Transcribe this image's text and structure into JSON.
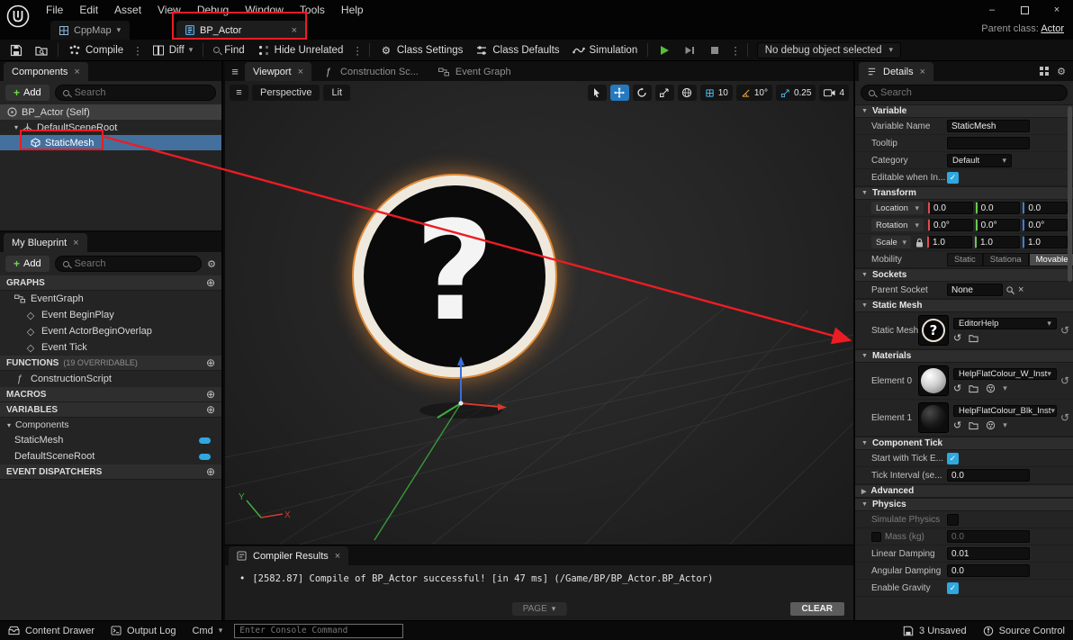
{
  "window": {
    "menus": [
      "File",
      "Edit",
      "Asset",
      "View",
      "Debug",
      "Window",
      "Tools",
      "Help"
    ],
    "parent_class_label": "Parent class:",
    "parent_class_value": "Actor"
  },
  "asset_tabs": {
    "level_tab": "CppMap",
    "blueprint_tab": "BP_Actor"
  },
  "toolbar": {
    "compile": "Compile",
    "diff": "Diff",
    "find": "Find",
    "hide_unrelated": "Hide Unrelated",
    "class_settings": "Class Settings",
    "class_defaults": "Class Defaults",
    "simulation": "Simulation",
    "debug_object": "No debug object selected"
  },
  "components_panel": {
    "title": "Components",
    "add_button": "Add",
    "search_placeholder": "Search",
    "items": [
      "BP_Actor (Self)",
      "DefaultSceneRoot",
      "StaticMesh"
    ]
  },
  "my_blueprint_panel": {
    "title": "My Blueprint",
    "add_button": "Add",
    "search_placeholder": "Search",
    "graphs_header": "GRAPHS",
    "graphs": [
      "EventGraph",
      "Event BeginPlay",
      "Event ActorBeginOverlap",
      "Event Tick"
    ],
    "functions_header": "FUNCTIONS",
    "functions_overridable": "(19 OVERRIDABLE)",
    "functions": [
      "ConstructionScript"
    ],
    "macros_header": "MACROS",
    "variables_header": "VARIABLES",
    "variables_group": "Components",
    "variables": [
      "StaticMesh",
      "DefaultSceneRoot"
    ],
    "event_dispatchers_header": "EVENT DISPATCHERS"
  },
  "viewport": {
    "tabs": [
      "Viewport",
      "Construction Sc...",
      "Event Graph"
    ],
    "perspective_button": "Perspective",
    "lit_button": "Lit",
    "grid_snap_value": "10",
    "rotation_snap_value": "10°",
    "scale_snap_value": "0.25",
    "camera_speed_value": "4",
    "axis_x_label": "X",
    "axis_y_label": "Y"
  },
  "compiler_results": {
    "title": "Compiler Results",
    "message": "[2582.87] Compile of BP_Actor successful! [in 47 ms] (/Game/BP/BP_Actor.BP_Actor)",
    "page_button": "PAGE",
    "clear_button": "CLEAR"
  },
  "details_panel": {
    "title": "Details",
    "search_placeholder": "Search",
    "variable_section": "Variable",
    "variable_name_label": "Variable Name",
    "variable_name_value": "StaticMesh",
    "tooltip_label": "Tooltip",
    "category_label": "Category",
    "category_value": "Default",
    "editable_label": "Editable when In...",
    "transform_section": "Transform",
    "location_label": "Location",
    "location_values": [
      "0.0",
      "0.0",
      "0.0"
    ],
    "rotation_label": "Rotation",
    "rotation_values": [
      "0.0°",
      "0.0°",
      "0.0°"
    ],
    "scale_label": "Scale",
    "scale_values": [
      "1.0",
      "1.0",
      "1.0"
    ],
    "mobility_label": "Mobility",
    "mobility_options": [
      "Static",
      "Stationa",
      "Movable"
    ],
    "sockets_section": "Sockets",
    "parent_socket_label": "Parent Socket",
    "parent_socket_value": "None",
    "static_mesh_section": "Static Mesh",
    "static_mesh_label": "Static Mesh",
    "static_mesh_value": "EditorHelp",
    "materials_section": "Materials",
    "element0_label": "Element 0",
    "element0_value": "HelpFlatColour_W_Inst",
    "element1_label": "Element 1",
    "element1_value": "HelpFlatColour_Blk_Inst",
    "component_tick_section": "Component Tick",
    "start_tick_label": "Start with Tick E...",
    "tick_interval_label": "Tick Interval (se...",
    "tick_interval_value": "0.0",
    "advanced_section": "Advanced",
    "physics_section": "Physics",
    "simulate_physics_label": "Simulate Physics",
    "mass_label": "Mass (kg)",
    "mass_value": "0.0",
    "linear_damping_label": "Linear Damping",
    "linear_damping_value": "0.01",
    "angular_damping_label": "Angular Damping",
    "angular_damping_value": "0.0",
    "enable_gravity_label": "Enable Gravity"
  },
  "statusbar": {
    "content_drawer": "Content Drawer",
    "output_log": "Output Log",
    "cmd": "Cmd",
    "console_placeholder": "Enter Console Command",
    "unsaved": "3 Unsaved",
    "source_control": "Source Control"
  },
  "icons": {
    "close": "×",
    "caret_down": "▾",
    "section_open": "▼",
    "section_closed": "▶",
    "circle_plus": "⊕",
    "check": "✓",
    "event_diamond": "◇",
    "function_glyph": "ƒ",
    "hamburger": "≡",
    "kebab": "⋮",
    "gear": "⚙",
    "reset_arrow": "↺",
    "bullet": "•",
    "expand_arrow": "▾",
    "minimize": "–"
  },
  "colors": {
    "annotation_red": "#ec1c24",
    "selection_blue": "#44709d",
    "accent_cyan": "#2fa7e0",
    "play_green": "#52c234",
    "ring_orange": "#f4963c"
  }
}
